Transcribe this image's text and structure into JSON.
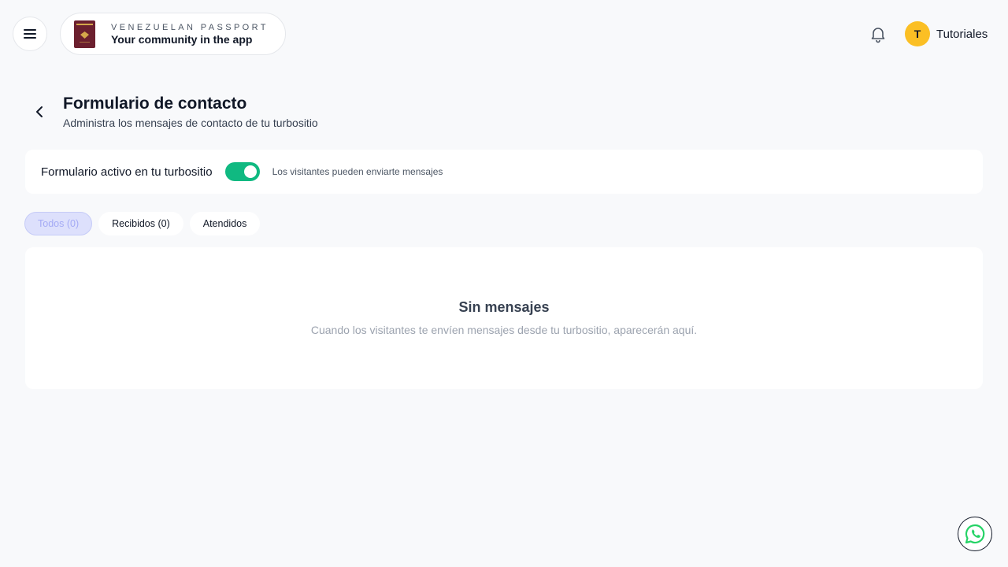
{
  "header": {
    "menu_icon": "hamburger-icon",
    "brand": {
      "top_text": "VENEZUELAN PASSPORT",
      "subtitle": "Your community in the app",
      "logo_color": "#6b1f2e"
    },
    "notifications_icon": "bell-icon",
    "user": {
      "initial": "T",
      "name": "Tutoriales",
      "avatar_color": "#fbbf24"
    }
  },
  "page": {
    "title": "Formulario de contacto",
    "subtitle": "Administra los mensajes de contacto de tu turbositio"
  },
  "form_toggle": {
    "label": "Formulario activo en tu turbositio",
    "enabled": true,
    "description": "Los visitantes pueden enviarte mensajes",
    "on_color": "#10b981"
  },
  "tabs": [
    {
      "label": "Todos (0)",
      "active": true
    },
    {
      "label": "Recibidos (0)",
      "active": false
    },
    {
      "label": "Atendidos",
      "active": false
    }
  ],
  "empty_state": {
    "title": "Sin mensajes",
    "description": "Cuando los visitantes te envíen mensajes desde tu turbositio, aparecerán aquí."
  },
  "floating": {
    "whatsapp_icon": "whatsapp-icon",
    "whatsapp_color": "#25d366"
  }
}
